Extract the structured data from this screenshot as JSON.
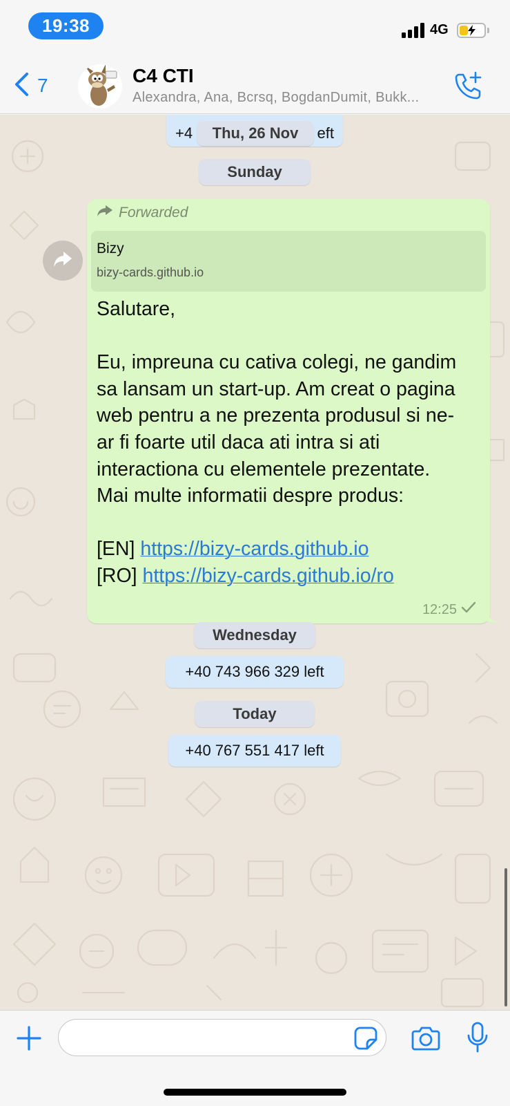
{
  "status_bar": {
    "time": "19:38",
    "network": "4G",
    "battery_level": 0.3,
    "battery_charging": true
  },
  "header": {
    "back_count": "7",
    "title": "C4 CTI",
    "members": "Alexandra, Ana, Bcrsq, BogdanDumit, Bukk..."
  },
  "chat": {
    "partial_system_left": "+4",
    "partial_system_right": "eft",
    "sticky_date": "Thu, 26 Nov",
    "date_sunday": "Sunday",
    "message": {
      "forwarded_label": "Forwarded",
      "link_preview": {
        "title": "Bizy",
        "domain": "bizy-cards.github.io"
      },
      "lines": [
        "Salutare,",
        "",
        "Eu, impreuna cu cativa colegi, ne gandim",
        "sa lansam un start-up. Am creat o pagina",
        "web pentru a ne prezenta produsul si ne-",
        "ar fi foarte util daca ati intra si ati",
        "interactiona cu elementele prezentate.",
        "Mai multe informatii despre produs:",
        ""
      ],
      "link_en_prefix": "[EN] ",
      "link_en": "https://bizy-cards.github.io",
      "link_ro_prefix": "[RO] ",
      "link_ro": "https://bizy-cards.github.io/ro",
      "time": "12:25"
    },
    "date_wednesday": "Wednesday",
    "system_wednesday": "+40 743 966 329 left",
    "date_today": "Today",
    "system_today": "+40 767 551 417 left"
  },
  "input": {
    "placeholder": ""
  },
  "colors": {
    "accent": "#1e82f0",
    "bubble_out": "#dcf8c6",
    "chat_bg": "#ece5dc",
    "date_pill": "#dde1ec",
    "system_pill": "#d6e9fa"
  }
}
